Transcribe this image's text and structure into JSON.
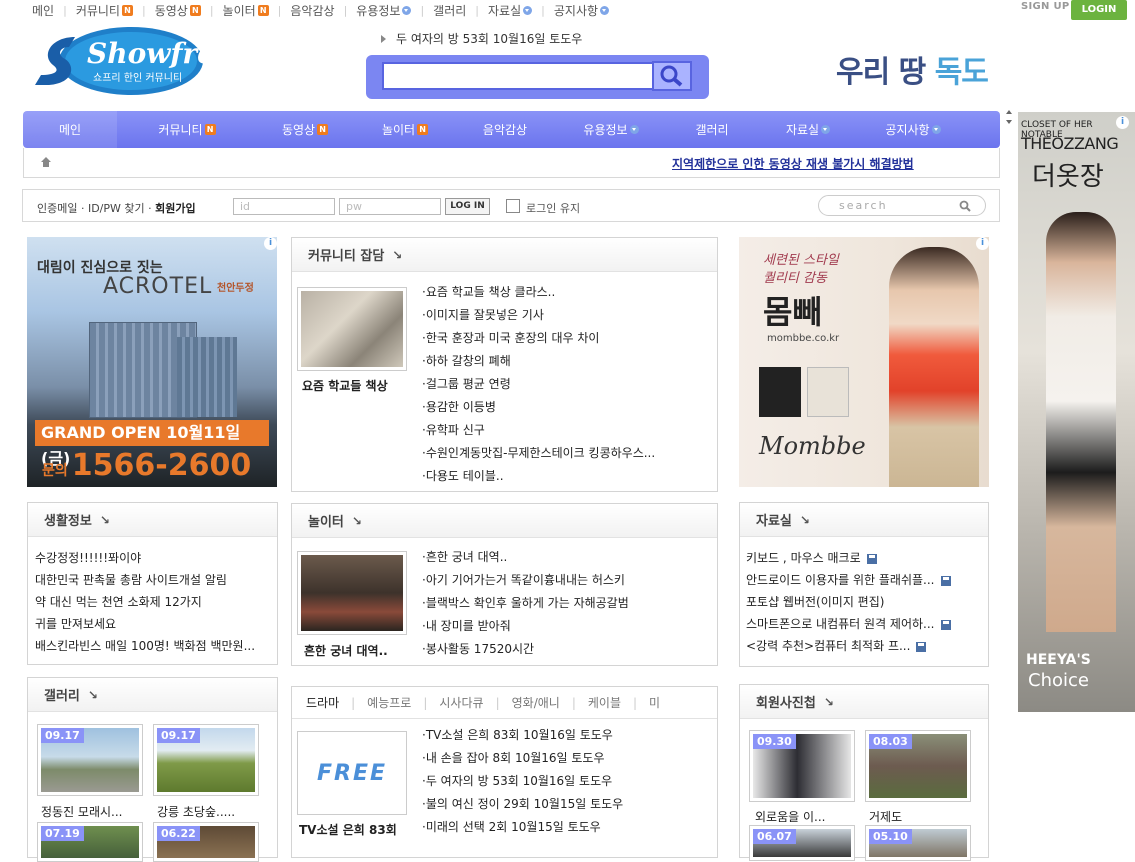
{
  "topnav": {
    "items": [
      {
        "label": "메인",
        "badge": "",
        "dropdown": false
      },
      {
        "label": "커뮤니티",
        "badge": "N",
        "dropdown": false
      },
      {
        "label": "동영상",
        "badge": "N",
        "dropdown": false
      },
      {
        "label": "놀이터",
        "badge": "N",
        "dropdown": false
      },
      {
        "label": "음악감상",
        "badge": "",
        "dropdown": false
      },
      {
        "label": "유용정보",
        "badge": "",
        "dropdown": true
      },
      {
        "label": "갤러리",
        "badge": "",
        "dropdown": false
      },
      {
        "label": "자료실",
        "badge": "",
        "dropdown": true
      },
      {
        "label": "공지사항",
        "badge": "",
        "dropdown": true
      }
    ],
    "signup": "SIGN UP",
    "login": "LOGIN"
  },
  "header": {
    "logo_text": "Showfree",
    "logo_sub": "쇼프리 한인 커뮤니티",
    "ticker": "두 여자의 방 53회 10월16일 토도우",
    "dokdo_a": "우리 땅 ",
    "dokdo_b": "독도"
  },
  "mainnav": {
    "items": [
      "메인",
      "커뮤니티",
      "동영상",
      "놀이터",
      "음악감상",
      "유용정보",
      "갤러리",
      "자료실",
      "공지사항"
    ],
    "notice": "지역제한으로 인한 동영상 재생 불가시 해결방법"
  },
  "loginbar": {
    "links_a": "인증메일 · ID/PW 찾기 · ",
    "links_b": "회원가입",
    "id_placeholder": "id",
    "pw_placeholder": "pw",
    "login_btn": "LOG IN",
    "keep": "로그인 유지",
    "search_placeholder": "search"
  },
  "ad_left": {
    "line1": "대림이 진심으로 짓는",
    "brand": "ACROTEL",
    "sub": "천안두정",
    "band": "GRAND OPEN 10월11일(금)",
    "inq": "문의",
    "phone": "1566-2600"
  },
  "community": {
    "title": "커뮤니티 잡담",
    "thumb_caption": "요즘 학교들 책상",
    "items": [
      "요즘 학교들 책상 클라스..",
      "이미지를 잘못넣은 기사",
      "한국 훈장과 미국 훈장의 대우 차이",
      "하하 갈창의 폐해",
      "걸그룹 평균 연령",
      "용감한 이등병",
      "유학파 신구",
      "수원인계동맛집-무제한스테이크 킹콩하우스...",
      "다용도 테이블.."
    ]
  },
  "ad_right": {
    "line1": "세련된 스타일",
    "line2": "퀄리티 감동",
    "brand": "몸빼",
    "url": "mombbe.co.kr",
    "script": "Mombbe"
  },
  "ad_tall": {
    "top": "CLOSET OF HER NOTABLE",
    "brand_en": "THEOZZANG",
    "brand_kr": "더옷장",
    "bottom1": "HEEYA'S",
    "bottom2": "Choice"
  },
  "life": {
    "title": "생활정보",
    "items": [
      "수강정정!!!!!!퐈이야",
      "대한민국 판촉물 총람 사이트개설 알림",
      "약 대신 먹는 천연 소화제 12가지",
      "귀를 만져보세요",
      "배스킨라빈스 매일 100명! 백화점 백만원..."
    ]
  },
  "playground": {
    "title": "놀이터",
    "thumb_caption": "흔한 궁녀 대역..",
    "items": [
      "흔한 궁녀 대역..",
      "아기 기어가는거 똑같이흉내내는 허스키",
      "블랙박스 확인후 울하게 가는 자해공갈범",
      "내 장미를 받아줘",
      "봉사활동 17520시간"
    ]
  },
  "archive": {
    "title": "자료실",
    "items": [
      "키보드 , 마우스 매크로",
      "안드로이드 이용자를 위한 플래쉬플...",
      "포토샵 웹버전(이미지 편집)",
      "스마트폰으로 내컴퓨터 원격 제어하...",
      "<강력 추천>컴퓨터 최적화 프..."
    ]
  },
  "gallery": {
    "title": "갤러리",
    "items": [
      {
        "date": "09.17",
        "caption": "정동진 모래시..."
      },
      {
        "date": "09.17",
        "caption": "강릉 초당숲....."
      },
      {
        "date": "07.19",
        "caption": ""
      },
      {
        "date": "06.22",
        "caption": ""
      }
    ]
  },
  "video": {
    "tabs": [
      "드라마",
      "예능프로",
      "시사다큐",
      "영화/애니",
      "케이블",
      "미"
    ],
    "thumb_caption": "TV소설 은희 83회",
    "thumb_text": "FREE",
    "items": [
      "TV소설 은희 83회 10월16일 토도우",
      "내 손을 잡아 8회 10월16일 토도우",
      "두 여자의 방 53회 10월16일 토도우",
      "불의 여신 정이 29회 10월15일 토도우",
      "미래의 선택 2회 10월15일 토도우"
    ]
  },
  "members": {
    "title": "회원사진첩",
    "items": [
      {
        "date": "09.30",
        "caption": "외로움을 이..."
      },
      {
        "date": "08.03",
        "caption": "거제도"
      },
      {
        "date": "06.07",
        "caption": ""
      },
      {
        "date": "05.10",
        "caption": ""
      }
    ]
  }
}
